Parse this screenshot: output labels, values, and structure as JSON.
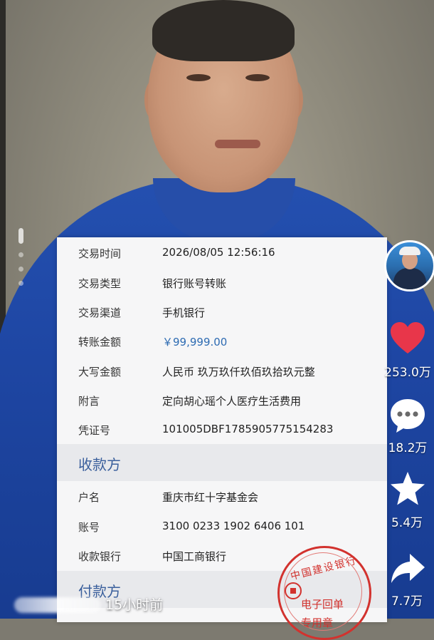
{
  "receipt": {
    "rows": [
      {
        "label": "交易时间",
        "value": "2026/08/05 12:56:16"
      },
      {
        "label": "交易类型",
        "value": "银行账号转账"
      },
      {
        "label": "交易渠道",
        "value": "手机银行"
      },
      {
        "label": "转账金额",
        "value": "￥99,999.00"
      },
      {
        "label": "大写金额",
        "value": "人民币 玖万玖仟玖佰玖拾玖元整"
      },
      {
        "label": "附言",
        "value": "定向胡心瑶个人医疗生活费用"
      },
      {
        "label": "凭证号",
        "value": "101005DBF1785905775154283"
      }
    ],
    "payee_section": "收款方",
    "payee_rows": [
      {
        "label": "户名",
        "value": "重庆市红十字基金会"
      },
      {
        "label": "账号",
        "value": "3100 0233 1902 6406 101"
      },
      {
        "label": "收款银行",
        "value": "中国工商银行"
      }
    ],
    "payer_section": "付款方",
    "amount_color": "#2d6bb2"
  },
  "seal": {
    "bank_name": "中国建设银行",
    "line1": "电子回单",
    "line2": "专用章",
    "color": "#d2322e"
  },
  "actions": {
    "like_count": "253.0万",
    "comment_count": "18.2万",
    "favorite_count": "5.4万",
    "share_count": "7.7万",
    "like_color": "#e8364a"
  },
  "post": {
    "time": "15小时前"
  }
}
